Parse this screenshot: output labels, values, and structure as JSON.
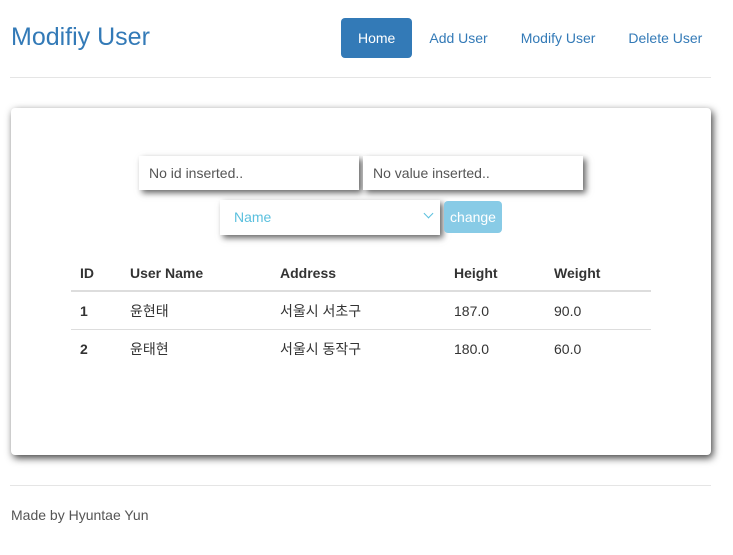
{
  "header": {
    "title": "Modifiy User",
    "nav": [
      "Home",
      "Add User",
      "Modify User",
      "Delete User"
    ]
  },
  "form": {
    "id_placeholder": "No id inserted..",
    "value_placeholder": "No value inserted..",
    "select_value": "Name",
    "change_label": "change"
  },
  "table": {
    "headers": [
      "ID",
      "User Name",
      "Address",
      "Height",
      "Weight"
    ],
    "rows": [
      [
        "1",
        "윤현태",
        "서울시 서초구",
        "187.0",
        "90.0"
      ],
      [
        "2",
        "윤태현",
        "서울시 동작구",
        "180.0",
        "60.0"
      ]
    ]
  },
  "footer": {
    "text": "Made by Hyuntae Yun"
  },
  "colors": {
    "accent": "#337ab7",
    "info": "#5bc0de"
  }
}
